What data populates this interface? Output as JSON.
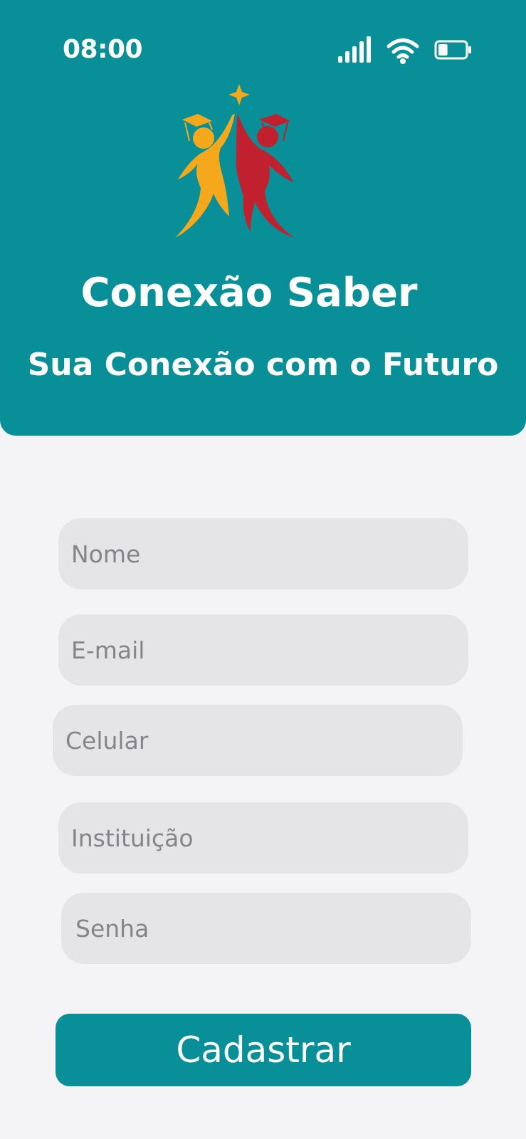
{
  "status_bar": {
    "time": "08:00",
    "signal_icon": "cellular-signal-icon",
    "wifi_icon": "wifi-icon",
    "battery_icon": "battery-icon",
    "battery_level": 0.35
  },
  "header": {
    "logo": "graduates-high-five-logo",
    "title": "Conexão Saber",
    "subtitle": "Sua Conexão com o Futuro",
    "background_color": "#088f97"
  },
  "form": {
    "fields": [
      {
        "placeholder": "Nome",
        "value": ""
      },
      {
        "placeholder": "E-mail",
        "value": ""
      },
      {
        "placeholder": "Celular",
        "value": ""
      },
      {
        "placeholder": "Instituição",
        "value": ""
      },
      {
        "placeholder": "Senha",
        "value": ""
      }
    ],
    "submit_label": "Cadastrar"
  },
  "colors": {
    "primary": "#088f97",
    "background": "#f4f4f6",
    "field_background": "#e5e5e7",
    "logo_yellow": "#f5a81c",
    "logo_red": "#c1202f"
  }
}
